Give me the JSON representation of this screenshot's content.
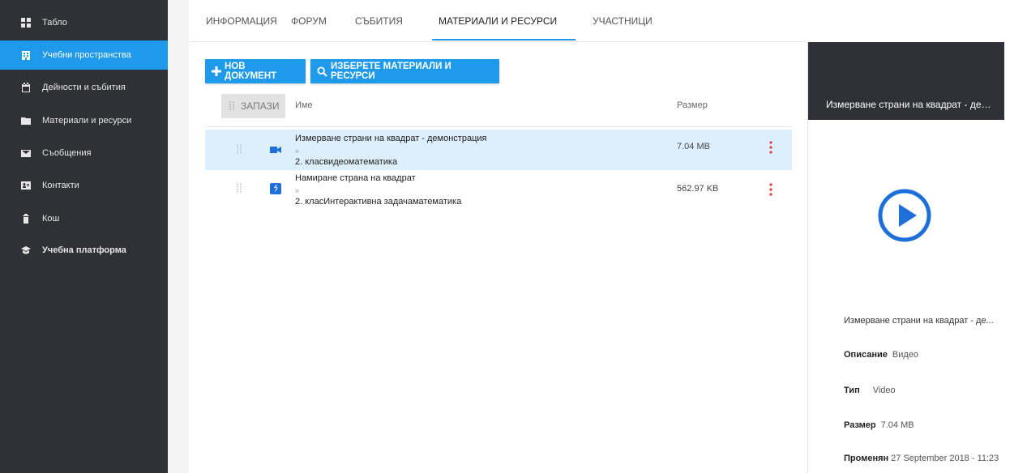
{
  "sidebar": {
    "items": [
      {
        "label": "Табло",
        "icon": "dashboard-icon"
      },
      {
        "label": "Учебни пространства",
        "icon": "building-icon"
      },
      {
        "label": "Дейности и събития",
        "icon": "calendar-icon"
      },
      {
        "label": "Материали и ресурси",
        "icon": "folder-icon"
      },
      {
        "label": "Съобщения",
        "icon": "mail-icon"
      },
      {
        "label": "Контакти",
        "icon": "contacts-icon"
      },
      {
        "label": "Кош",
        "icon": "trash-icon"
      },
      {
        "label": "Учебна платформа",
        "icon": "graduation-cap-icon"
      }
    ]
  },
  "tabs": [
    {
      "label": "ИНФОРМАЦИЯ"
    },
    {
      "label": "ФОРУМ"
    },
    {
      "label": "СЪБИТИЯ"
    },
    {
      "label": "МАТЕРИАЛИ И РЕСУРСИ"
    },
    {
      "label": "УЧАСТНИЦИ"
    }
  ],
  "toolbar": {
    "new_doc_label": "НОВ ДОКУМЕНТ",
    "select_label": "ИЗБЕРЕТЕ МАТЕРИАЛИ И РЕСУРСИ"
  },
  "table": {
    "save_label": "ЗАПАЗИ",
    "col_name": "Име",
    "col_size": "Размер",
    "rows": [
      {
        "title": "Измерване страни на квадрат - демонстрация",
        "sep": "»",
        "path": "2. класвидеоматематика",
        "size": "7.04 MB",
        "icon": "video-icon"
      },
      {
        "title": "Намиране страна на квадрат",
        "sep": "»",
        "path": "2. класИнтерактивна задачаматематика",
        "size": "562.97 KB",
        "icon": "interactive-task-icon"
      }
    ]
  },
  "panel": {
    "title": "Измерване страни на квадрат - демо...",
    "name": "Измерване страни на квадрат - де...",
    "desc_label": "Описание",
    "desc_value": "Видео",
    "type_label": "Тип",
    "type_value": "Video",
    "size_label": "Размер",
    "size_value": "7.04 MB",
    "changed_label": "Променян",
    "changed_value": "27 September 2018 - 11:23"
  },
  "colors": {
    "accent": "#1f9aea",
    "sidebar_bg": "#2f3136",
    "more_menu": "#e53935",
    "selected_row": "#ddeefd"
  }
}
